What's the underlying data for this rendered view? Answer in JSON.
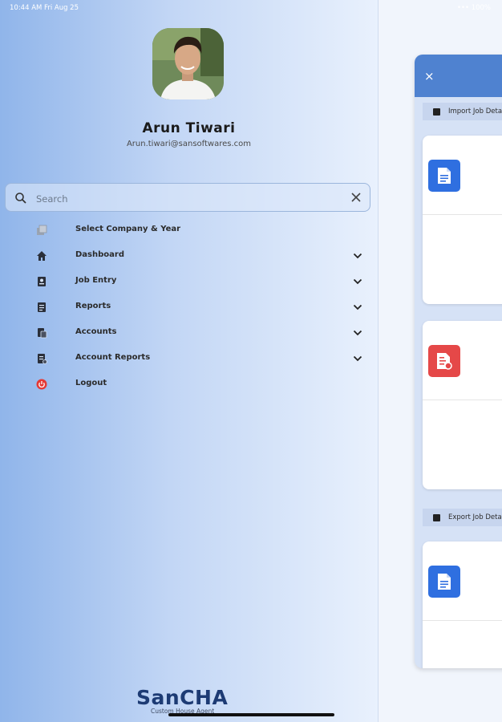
{
  "status_bar": {
    "time": "10:44 AM  Fri Aug 25",
    "indicators": "••• 100%"
  },
  "profile": {
    "name": "Arun Tiwari",
    "email": "Arun.tiwari@sansoftwares.com"
  },
  "search": {
    "placeholder": "Search",
    "value": ""
  },
  "menu": [
    {
      "label": "Select Company & Year",
      "icon": "company-icon",
      "expandable": false
    },
    {
      "label": "Dashboard",
      "icon": "home-icon",
      "expandable": true
    },
    {
      "label": "Job Entry",
      "icon": "job-entry-icon",
      "expandable": true
    },
    {
      "label": "Reports",
      "icon": "reports-icon",
      "expandable": true
    },
    {
      "label": "Accounts",
      "icon": "accounts-icon",
      "expandable": true
    },
    {
      "label": "Account Reports",
      "icon": "account-reports-icon",
      "expandable": true
    },
    {
      "label": "Logout",
      "icon": "power-icon",
      "expandable": false
    }
  ],
  "background_panel": {
    "close": "×",
    "import_section": "Import Job Deta",
    "export_section": "Export Job Deta"
  },
  "brand": {
    "name": "SanCHA",
    "tagline": "Custom House Agent"
  },
  "colors": {
    "accent": "#4f82d0",
    "doc_blue": "#2f6fe0",
    "doc_red": "#e54848",
    "logout_red": "#e53935"
  }
}
